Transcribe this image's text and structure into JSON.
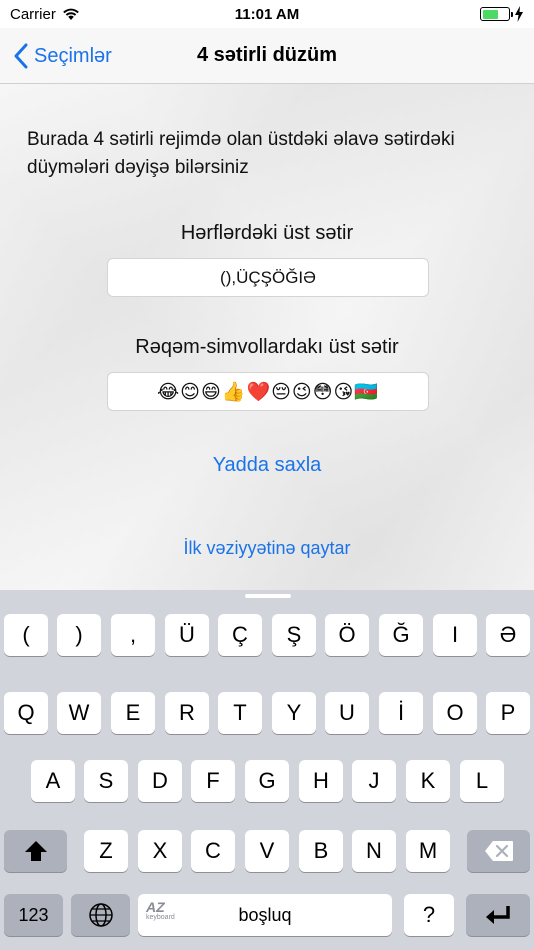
{
  "status": {
    "carrier": "Carrier",
    "time": "11:01 AM",
    "battery_level_percent": 60
  },
  "nav": {
    "back_label": "Seçimlər",
    "title": "4 sətirli düzüm"
  },
  "content": {
    "description": "Burada 4 sətirli rejimdə olan üstdəki əlavə sətirdəki düymələri dəyişə bilərsiniz",
    "letters_label": "Hərflərdəki üst sətir",
    "letters_value": "(),ÜÇŞÖĞIƏ",
    "symbols_label": "Rəqəm-simvollardakı üst sətir",
    "symbols_value": "😂😊😄👍❤️😔😉😳😘🇦🇿",
    "save_label": "Yadda saxla",
    "reset_label": "İlk vəziyyətinə qaytar"
  },
  "keyboard": {
    "row1": [
      "(",
      ")",
      ",",
      "Ü",
      "Ç",
      "Ş",
      "Ö",
      "Ğ",
      "I",
      "Ə"
    ],
    "row2": [
      "Q",
      "W",
      "E",
      "R",
      "T",
      "Y",
      "U",
      "İ",
      "O",
      "P"
    ],
    "row3": [
      "A",
      "S",
      "D",
      "F",
      "G",
      "H",
      "J",
      "K",
      "L"
    ],
    "row4": [
      "Z",
      "X",
      "C",
      "V",
      "B",
      "N",
      "M"
    ],
    "numbers_label": "123",
    "az_label": "AZ",
    "az_sublabel": "keyboard",
    "space_label": "boşluq",
    "question_label": "?"
  }
}
